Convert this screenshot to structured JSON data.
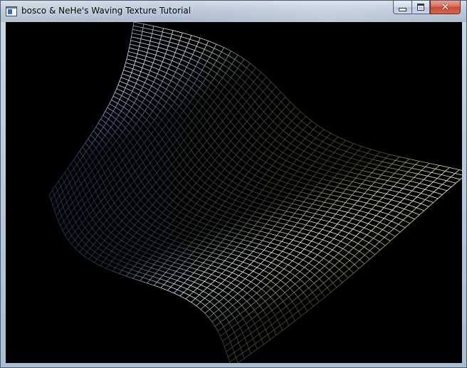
{
  "window": {
    "title": "bosco & NeHe's Waving Texture Tutorial",
    "controls": {
      "minimize": "minimize",
      "maximize": "maximize",
      "close": "close"
    }
  },
  "viewport": {
    "background": "#000000",
    "content": "waving textured flag rendered as wireframe grid",
    "colors": {
      "cool": "#7aa6ff",
      "warm": "#e9f08f",
      "highlight": "#ffffff"
    }
  }
}
